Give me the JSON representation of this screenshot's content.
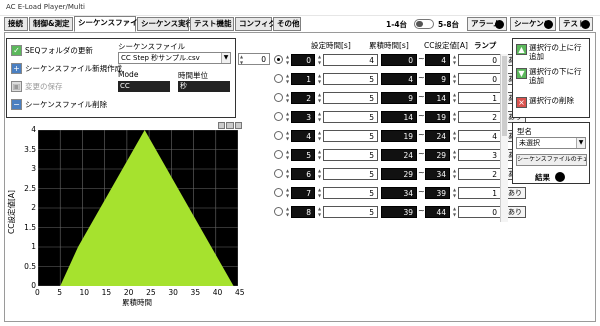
{
  "window": {
    "title": "AC E-Load Player/Multi"
  },
  "tabs": [
    {
      "label": "接続"
    },
    {
      "label": "制御&測定"
    },
    {
      "label": "シーケンスファイル"
    },
    {
      "label": "シーケンス実行"
    },
    {
      "label": "テスト機能"
    },
    {
      "label": "コンフィグ"
    },
    {
      "label": "その他"
    }
  ],
  "unit_toggle": {
    "left": "1-4台",
    "right": "5-8台",
    "value": "1-4台"
  },
  "indicators": {
    "alarm": "アラーム",
    "sequence": "シーケンス",
    "test": "テスト"
  },
  "file_panel": {
    "btn_update": "SEQフォルダの更新",
    "btn_new": "シーケンスファイル新規作成",
    "btn_save": "変更の保存",
    "btn_delete": "シーケンスファイル削除",
    "seqfile_label": "シーケンスファイル",
    "seqfile_value": "CC Step 秒サンプル.csv",
    "mode_label": "Mode",
    "mode_value": "CC",
    "time_unit_label": "時間単位",
    "time_unit_value": "秒"
  },
  "index_control": {
    "value": "0"
  },
  "chart_data": {
    "type": "area",
    "xlabel": "累積時間",
    "ylabel": "CC設定値[A]",
    "xlim": [
      0,
      45
    ],
    "ylim": [
      0,
      4
    ],
    "xticks": [
      "0",
      "5",
      "10",
      "15",
      "20",
      "25",
      "30",
      "35",
      "40",
      "45"
    ],
    "yticks": [
      "0",
      "0.5",
      "1",
      "1.5",
      "2",
      "2.5",
      "3",
      "3.5",
      "4"
    ],
    "grid": true,
    "fill_color": "#a6e22e",
    "background": "#000000",
    "grid_color": "#6a6a6a",
    "x": [
      0,
      5,
      9,
      14,
      19,
      24,
      29,
      34,
      39,
      44
    ],
    "values": [
      0,
      0,
      1,
      2,
      3,
      4,
      3,
      2,
      1,
      0
    ]
  },
  "table": {
    "headers": {
      "time": "設定時間[s]",
      "cumulative": "累積時間[s]",
      "cc": "CC設定値[A]",
      "lamp": "ランプ"
    },
    "rows": [
      {
        "index": "0",
        "time": "4",
        "cum_start": "0",
        "cum_end": "4",
        "cc": "0",
        "lamp": "あり"
      },
      {
        "index": "1",
        "time": "5",
        "cum_start": "4",
        "cum_end": "9",
        "cc": "0",
        "lamp": "あり"
      },
      {
        "index": "2",
        "time": "5",
        "cum_start": "9",
        "cum_end": "14",
        "cc": "1",
        "lamp": "あり"
      },
      {
        "index": "3",
        "time": "5",
        "cum_start": "14",
        "cum_end": "19",
        "cc": "2",
        "lamp": "あり"
      },
      {
        "index": "4",
        "time": "5",
        "cum_start": "19",
        "cum_end": "24",
        "cc": "4",
        "lamp": "あり"
      },
      {
        "index": "5",
        "time": "5",
        "cum_start": "24",
        "cum_end": "29",
        "cc": "3",
        "lamp": "あり"
      },
      {
        "index": "6",
        "time": "5",
        "cum_start": "29",
        "cum_end": "34",
        "cc": "2",
        "lamp": "あり"
      },
      {
        "index": "7",
        "time": "5",
        "cum_start": "34",
        "cum_end": "39",
        "cc": "1",
        "lamp": "あり"
      },
      {
        "index": "8",
        "time": "5",
        "cum_start": "39",
        "cum_end": "44",
        "cc": "0",
        "lamp": "あり"
      }
    ]
  },
  "row_panel": {
    "btn_add_above": "選択行の上に行追加",
    "btn_add_below": "選択行の下に行追加",
    "btn_delete": "選択行の削除"
  },
  "model_panel": {
    "label": "型名",
    "value": "未選択",
    "check_button": "シーケンスファイルのチェック",
    "result_label": "結果"
  }
}
